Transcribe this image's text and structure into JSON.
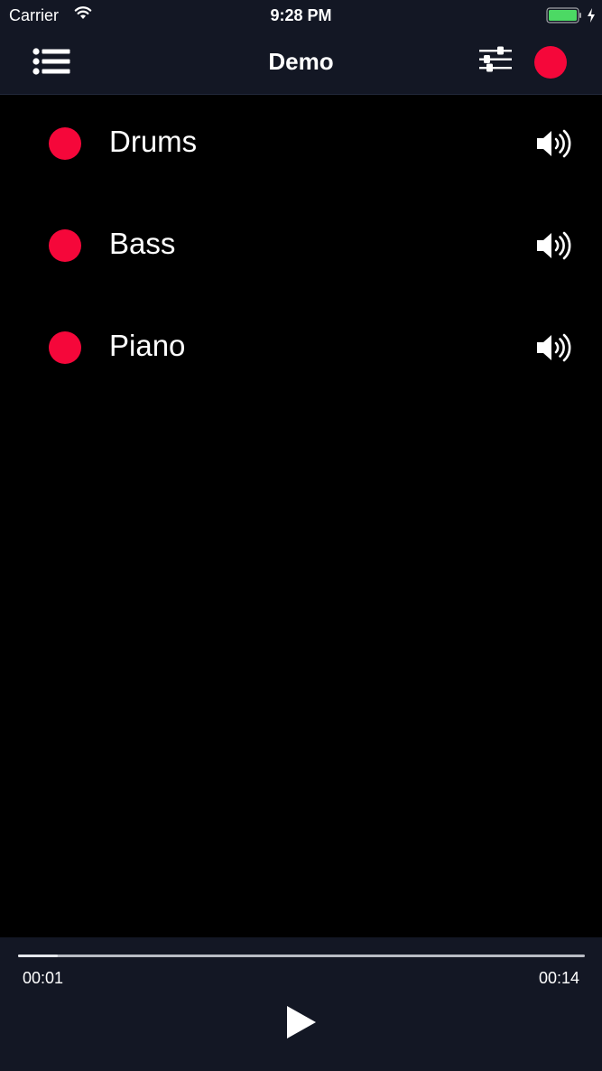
{
  "status_bar": {
    "carrier": "Carrier",
    "time": "9:28 PM",
    "battery_color": "#4cd964"
  },
  "nav": {
    "title": "Demo",
    "left_icon": "list-menu-icon",
    "right_icons": [
      "mixer-sliders-icon",
      "record-icon"
    ]
  },
  "tracks": [
    {
      "name": "Drums",
      "indicator_color": "#f5073a",
      "icon": "speaker-icon"
    },
    {
      "name": "Bass",
      "indicator_color": "#f5073a",
      "icon": "speaker-icon"
    },
    {
      "name": "Piano",
      "indicator_color": "#f5073a",
      "icon": "speaker-icon"
    }
  ],
  "transport": {
    "elapsed": "00:01",
    "total": "00:14",
    "progress_fraction": 0.07,
    "play_icon": "play-icon"
  },
  "colors": {
    "accent": "#f5073a",
    "bar_background": "#131724",
    "content_background": "#000000"
  }
}
